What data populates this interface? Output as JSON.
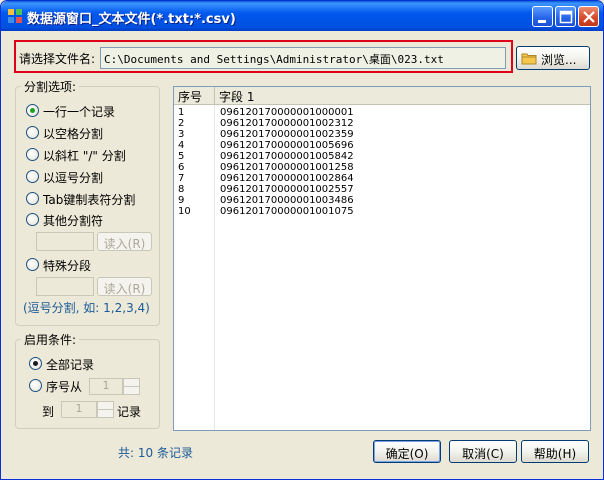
{
  "window": {
    "title": "数据源窗口_文本文件(*.txt;*.csv)"
  },
  "file": {
    "label": "请选择文件名:",
    "path": "C:\\Documents and Settings\\Administrator\\桌面\\023.txt",
    "browse_label": "浏览..."
  },
  "split": {
    "title": "分割选项:",
    "options": [
      {
        "label": "一行一个记录",
        "checked": true
      },
      {
        "label": "以空格分割",
        "checked": false
      },
      {
        "label": "以斜杠 \"/\" 分割",
        "checked": false
      },
      {
        "label": "以逗号分割",
        "checked": false
      },
      {
        "label": "Tab键制表符分割",
        "checked": false
      },
      {
        "label": "其他分割符",
        "checked": false
      },
      {
        "label": "特殊分段",
        "checked": false
      }
    ],
    "read_label": "读入(R)",
    "hint": "(逗号分割, 如: 1,2,3,4)"
  },
  "condition": {
    "title": "启用条件:",
    "all_label": "全部记录",
    "from_label": "序号从",
    "to_label": "到",
    "records_label": "记录",
    "from_value": "1",
    "to_value": "1"
  },
  "table": {
    "headers": [
      "序号",
      "字段 1"
    ],
    "rows": [
      [
        "1",
        "096120170000001000001"
      ],
      [
        "2",
        "096120170000001002312"
      ],
      [
        "3",
        "096120170000001002359"
      ],
      [
        "4",
        "096120170000001005696"
      ],
      [
        "5",
        "096120170000001005842"
      ],
      [
        "6",
        "096120170000001001258"
      ],
      [
        "7",
        "096120170000001002864"
      ],
      [
        "8",
        "096120170000001002557"
      ],
      [
        "9",
        "096120170000001003486"
      ],
      [
        "10",
        "096120170000001001075"
      ]
    ]
  },
  "footer": {
    "count_text": "共: 10 条记录",
    "ok_label": "确定(O)",
    "cancel_label": "取消(C)",
    "help_label": "帮助(H)"
  }
}
